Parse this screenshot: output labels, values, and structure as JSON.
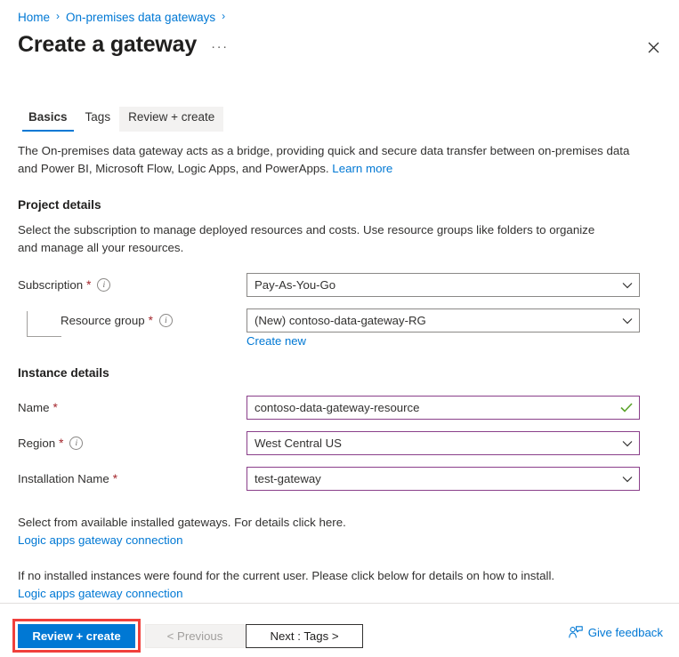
{
  "breadcrumb": {
    "items": [
      {
        "label": "Home"
      },
      {
        "label": "On-premises data gateways"
      }
    ],
    "separator": "›"
  },
  "header": {
    "title": "Create a gateway",
    "ellipsis": "···",
    "close_label": "✕"
  },
  "tabs": [
    {
      "label": "Basics",
      "selected": true
    },
    {
      "label": "Tags",
      "selected": false
    },
    {
      "label": "Review + create",
      "selected": false,
      "hovered": true
    }
  ],
  "intro": {
    "text": "The On-premises data gateway acts as a bridge, providing quick and secure data transfer between on-premises data and Power BI, Microsoft Flow, Logic Apps, and PowerApps.",
    "link": "Learn more"
  },
  "project_details": {
    "heading": "Project details",
    "description": "Select the subscription to manage deployed resources and costs. Use resource groups like folders to organize and manage all your resources.",
    "subscription": {
      "label": "Subscription",
      "required": "*",
      "value": "Pay-As-You-Go"
    },
    "resource_group": {
      "label": "Resource group",
      "required": "*",
      "value": "(New) contoso-data-gateway-RG",
      "create_new_link": "Create new"
    }
  },
  "instance_details": {
    "heading": "Instance details",
    "name": {
      "label": "Name",
      "required": "*",
      "value": "contoso-data-gateway-resource",
      "validation": "valid"
    },
    "region": {
      "label": "Region",
      "required": "*",
      "value": "West Central US"
    },
    "installation_name": {
      "label": "Installation Name",
      "required": "*",
      "value": "test-gateway"
    }
  },
  "notes": {
    "first_text": "Select from available installed gateways. For details click here.",
    "first_link": "Logic apps gateway connection",
    "second_text": "If no installed instances were found for the current user. Please click below for details on how to install.",
    "second_link": "Logic apps gateway connection"
  },
  "footer": {
    "review_create": "Review + create",
    "previous": "< Previous",
    "next": "Next : Tags >",
    "give_feedback": "Give feedback"
  },
  "colors": {
    "accent": "#0078d4",
    "required_asterisk": "#a4262c",
    "valid_border": "#8a3f8a",
    "valid_check": "#5ba32b",
    "highlight_box": "#f0403c"
  }
}
